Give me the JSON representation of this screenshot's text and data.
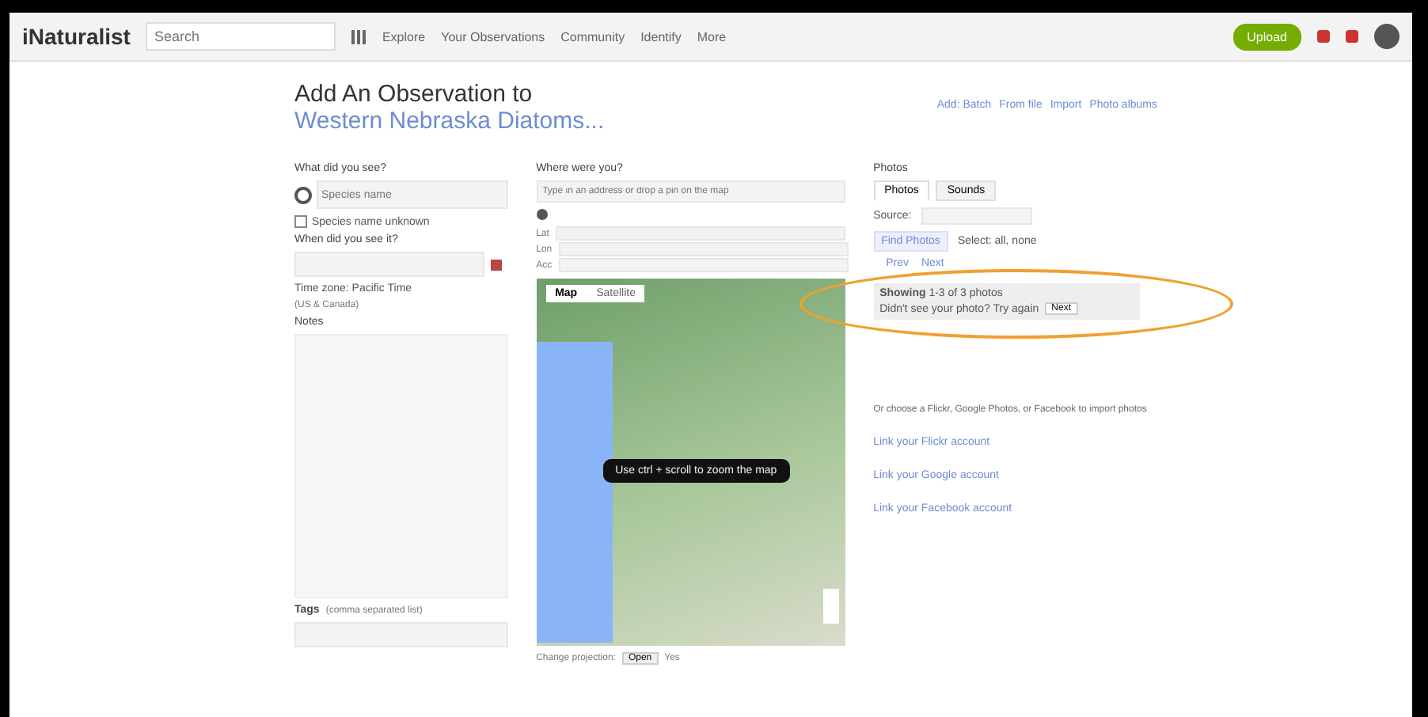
{
  "header": {
    "logo": "iNaturalist",
    "search": {
      "placeholder": "Search"
    },
    "nav": [
      "Explore",
      "Your Observations",
      "Community",
      "Identify",
      "More"
    ],
    "upload": "Upload"
  },
  "title": {
    "text": "Add An Observation to ",
    "link": "Western Nebraska Diatoms..."
  },
  "add_links": [
    "Add: Batch",
    "From file",
    "Import",
    "Photo albums"
  ],
  "left": {
    "what_label": "What did you see?",
    "species_placeholder": "Species name",
    "unknown": {
      "label": "Species name unknown",
      "checked": false
    },
    "when_label": "When did you see it?",
    "time_zone": "Time zone: Pacific Time",
    "time_zone_hint": "(US & Canada)",
    "notes_label": "Notes",
    "tags_label": "Tags",
    "tags_hint": "(comma separated list)"
  },
  "middle": {
    "where_label": "Where were you?",
    "place_placeholder": "Type in an address or drop a pin on the map",
    "coords": [
      {
        "label": "Lat"
      },
      {
        "label": "Lon"
      },
      {
        "label": "Acc"
      }
    ],
    "map_tabs": [
      {
        "label": "Map",
        "selected": true
      },
      {
        "label": "Satellite",
        "selected": false
      }
    ],
    "map_hint": "Use ctrl + scroll to zoom the map",
    "projection_label": "Change projection:",
    "projection_value": "Open",
    "projection_extra": "Yes"
  },
  "right": {
    "photos_label": "Photos",
    "tabs": [
      {
        "label": "Photos",
        "selected": true
      },
      {
        "label": "Sounds",
        "selected": false
      }
    ],
    "source_label": "Source:",
    "find_button": "Find Photos",
    "select_label": "Select: all, none",
    "pager": [
      "Prev",
      "Next"
    ],
    "notice_bold": "Showing",
    "notice_text": "1-3 of 3 photos",
    "notice_line2": "Didn't see your photo? Try again",
    "notice_button": "Next",
    "info": "Or choose a Flickr, Google Photos, or Facebook to import photos",
    "links": [
      "Link your Flickr account",
      "Link your Google account",
      "Link your Facebook account"
    ]
  }
}
